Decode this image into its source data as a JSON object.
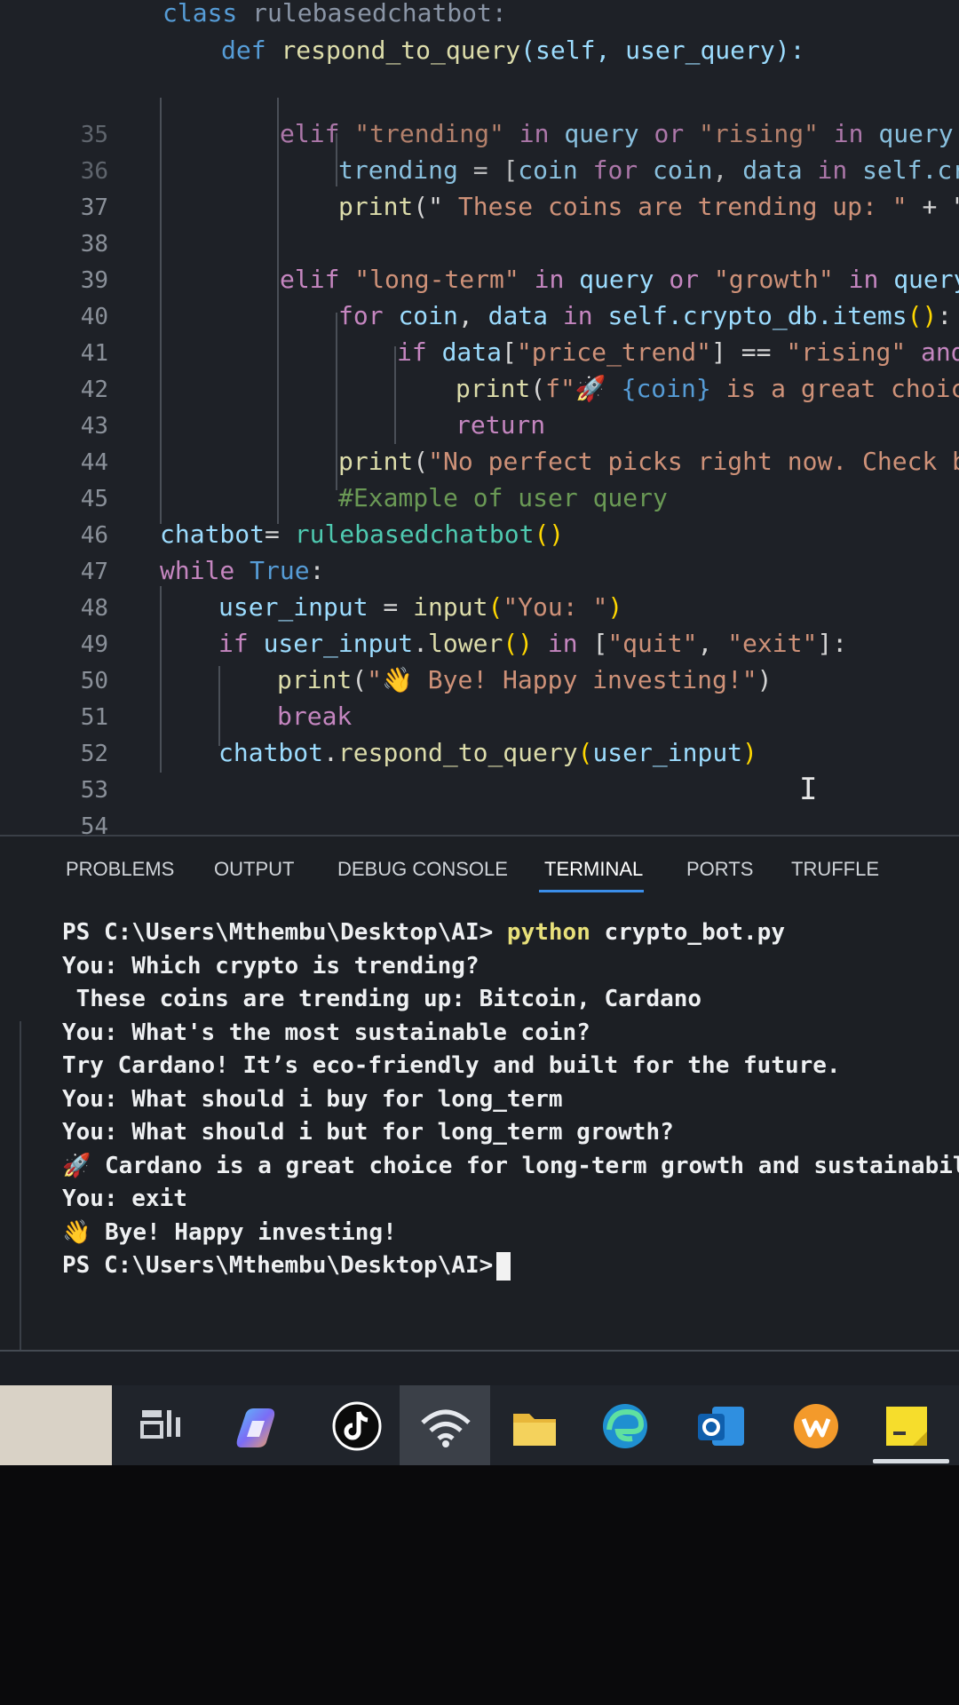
{
  "editor": {
    "line_numbers": [
      "35",
      "36",
      "37",
      "38",
      "39",
      "40",
      "41",
      "42",
      "43",
      "44",
      "45",
      "46",
      "47",
      "48",
      "49",
      "50",
      "51",
      "52",
      "53",
      "54"
    ],
    "header_line1": {
      "kw": "class",
      "name": "rulebasedchatbot:"
    },
    "header_line2": {
      "kw": "def",
      "fn": "respond_to_query",
      "args": "(self, user_query):"
    }
  },
  "panel": {
    "tabs": [
      "PROBLEMS",
      "OUTPUT",
      "DEBUG CONSOLE",
      "TERMINAL",
      "PORTS",
      "TRUFFLE"
    ],
    "active_tab": "TERMINAL"
  },
  "terminal": {
    "prompt": "PS C:\\Users\\Mthembu\\Desktop\\AI>",
    "command_program": "python",
    "command_arg": "crypto_bot.py",
    "lines": [
      "You: Which crypto is trending?",
      " These coins are trending up: Bitcoin, Cardano",
      "You: What's the most sustainable coin?",
      "Try Cardano! It’s eco-friendly and built for the future.",
      "You: What should i buy for long_term",
      "You: What should i but for long_term growth?",
      "🚀 Cardano is a great choice for long-term growth and sustainabili",
      "You: exit",
      "👋 Bye! Happy investing!"
    ],
    "final_prompt": "PS C:\\Users\\Mthembu\\Desktop\\AI>"
  },
  "taskbar": {
    "icons": [
      "task-view-icon",
      "copilot-icon",
      "tiktok-icon",
      "wifi-icon",
      "file-explorer-icon",
      "edge-icon",
      "outlook-icon",
      "wps-office-icon",
      "sticky-notes-icon"
    ],
    "colors": {
      "copilot": "#4fa3f7",
      "tiktok": "#000000",
      "folder": "#f1c74b",
      "edge": "#2fb0d8",
      "outlook": "#1a74c8",
      "wps": "#f39a2b",
      "sticky": "#f6dd2c"
    }
  }
}
